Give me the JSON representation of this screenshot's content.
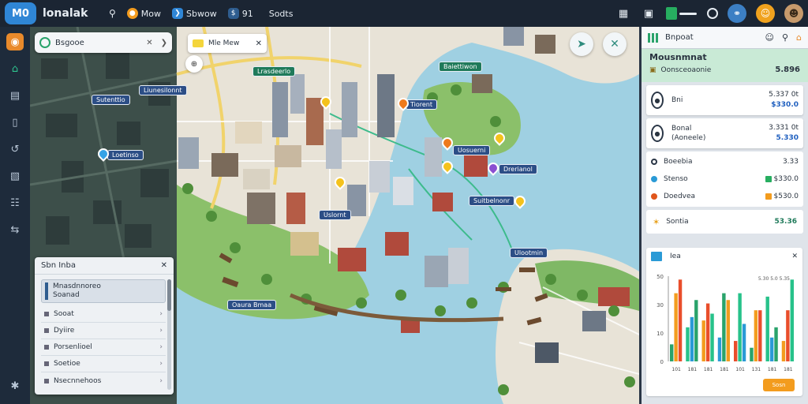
{
  "app": {
    "logo_text": "M0",
    "title": "lonalak"
  },
  "topbar": {
    "items": [
      {
        "icon": "search-icon",
        "label": ""
      },
      {
        "icon": "orange-circle-icon",
        "label": "Mow",
        "color": "#f39c1e"
      },
      {
        "icon": "chevron-right-icon",
        "label": "Sbwow",
        "color": "#2f86d6"
      },
      {
        "icon": "dollar-icon",
        "label": "91",
        "color": "#2f5d8f"
      },
      {
        "icon": "",
        "label": "Sodts"
      }
    ]
  },
  "map": {
    "search": {
      "title": "Bsgooe"
    },
    "info_chip": {
      "label": "Mle Mew"
    },
    "labels": [
      {
        "text": "Lrasdeerlo",
        "left": "",
        "kind": "green"
      },
      {
        "text": "Baiettiwon"
      },
      {
        "text": "Sutenttio"
      },
      {
        "text": "Liunesilonnt"
      },
      {
        "text": "Loetinso"
      },
      {
        "text": "Tiorent"
      },
      {
        "text": "Uosuerni"
      },
      {
        "text": "Drerianol"
      },
      {
        "text": "Uslornt"
      },
      {
        "text": "Suitbelnonr"
      },
      {
        "text": "Ulootmin"
      },
      {
        "text": "Oaura Bmaa"
      }
    ],
    "layers": {
      "title": "Sbn Inba",
      "selected": [
        "Mnasdnnoreo",
        "Soanad"
      ],
      "rows": [
        "Sooat",
        "Dyiire",
        "Porsenlioel",
        "Soetioe",
        "Nsecnnehoos"
      ]
    }
  },
  "panel": {
    "header": "Bnpoat",
    "summary": {
      "title": "Mousnmnat",
      "row_label": "Oonsceoaonie",
      "row_value": "5.896"
    },
    "cards": [
      {
        "label": "Bni",
        "sub": "",
        "v1": "5.337 0t",
        "v2": "$330.0"
      },
      {
        "label": "Bonal",
        "sub": "(Aoneele)",
        "v1": "3.331 0t",
        "v2": "5.330"
      }
    ],
    "list": [
      {
        "label": "Boeebia",
        "color": "#2a3646",
        "value": "3.33"
      },
      {
        "label": "Stenso",
        "color": "#2a9ad6",
        "value": "$330.0",
        "sq": "#27ae60"
      },
      {
        "label": "Doedvea",
        "color": "#e0561c",
        "value": "$530.0",
        "sq": "#f39c1e"
      }
    ],
    "sum": {
      "label": "Sontia",
      "value": "53.36"
    },
    "chart": {
      "title": "Iea",
      "button": "Sosn",
      "legend": "5.30 5.0 5.35",
      "colors": [
        "#2aa36b",
        "#27c28a",
        "#f39c1e",
        "#2a9ad6",
        "#e94e2b"
      ]
    }
  },
  "chart_data": {
    "type": "bar",
    "categories": [
      "101",
      "181",
      "181",
      "181",
      "101",
      "131",
      "181",
      "181"
    ],
    "series": [
      {
        "values": [
          10,
          20,
          24,
          14,
          12,
          8,
          38,
          12
        ]
      },
      {
        "values": [
          40,
          26,
          34,
          40,
          40,
          30,
          14,
          30
        ]
      },
      {
        "values": [
          48,
          36,
          28,
          36,
          22,
          30,
          20,
          48
        ]
      }
    ],
    "yticks": [
      "0",
      "10",
      "30",
      "50"
    ],
    "ylim": [
      0,
      50
    ]
  }
}
